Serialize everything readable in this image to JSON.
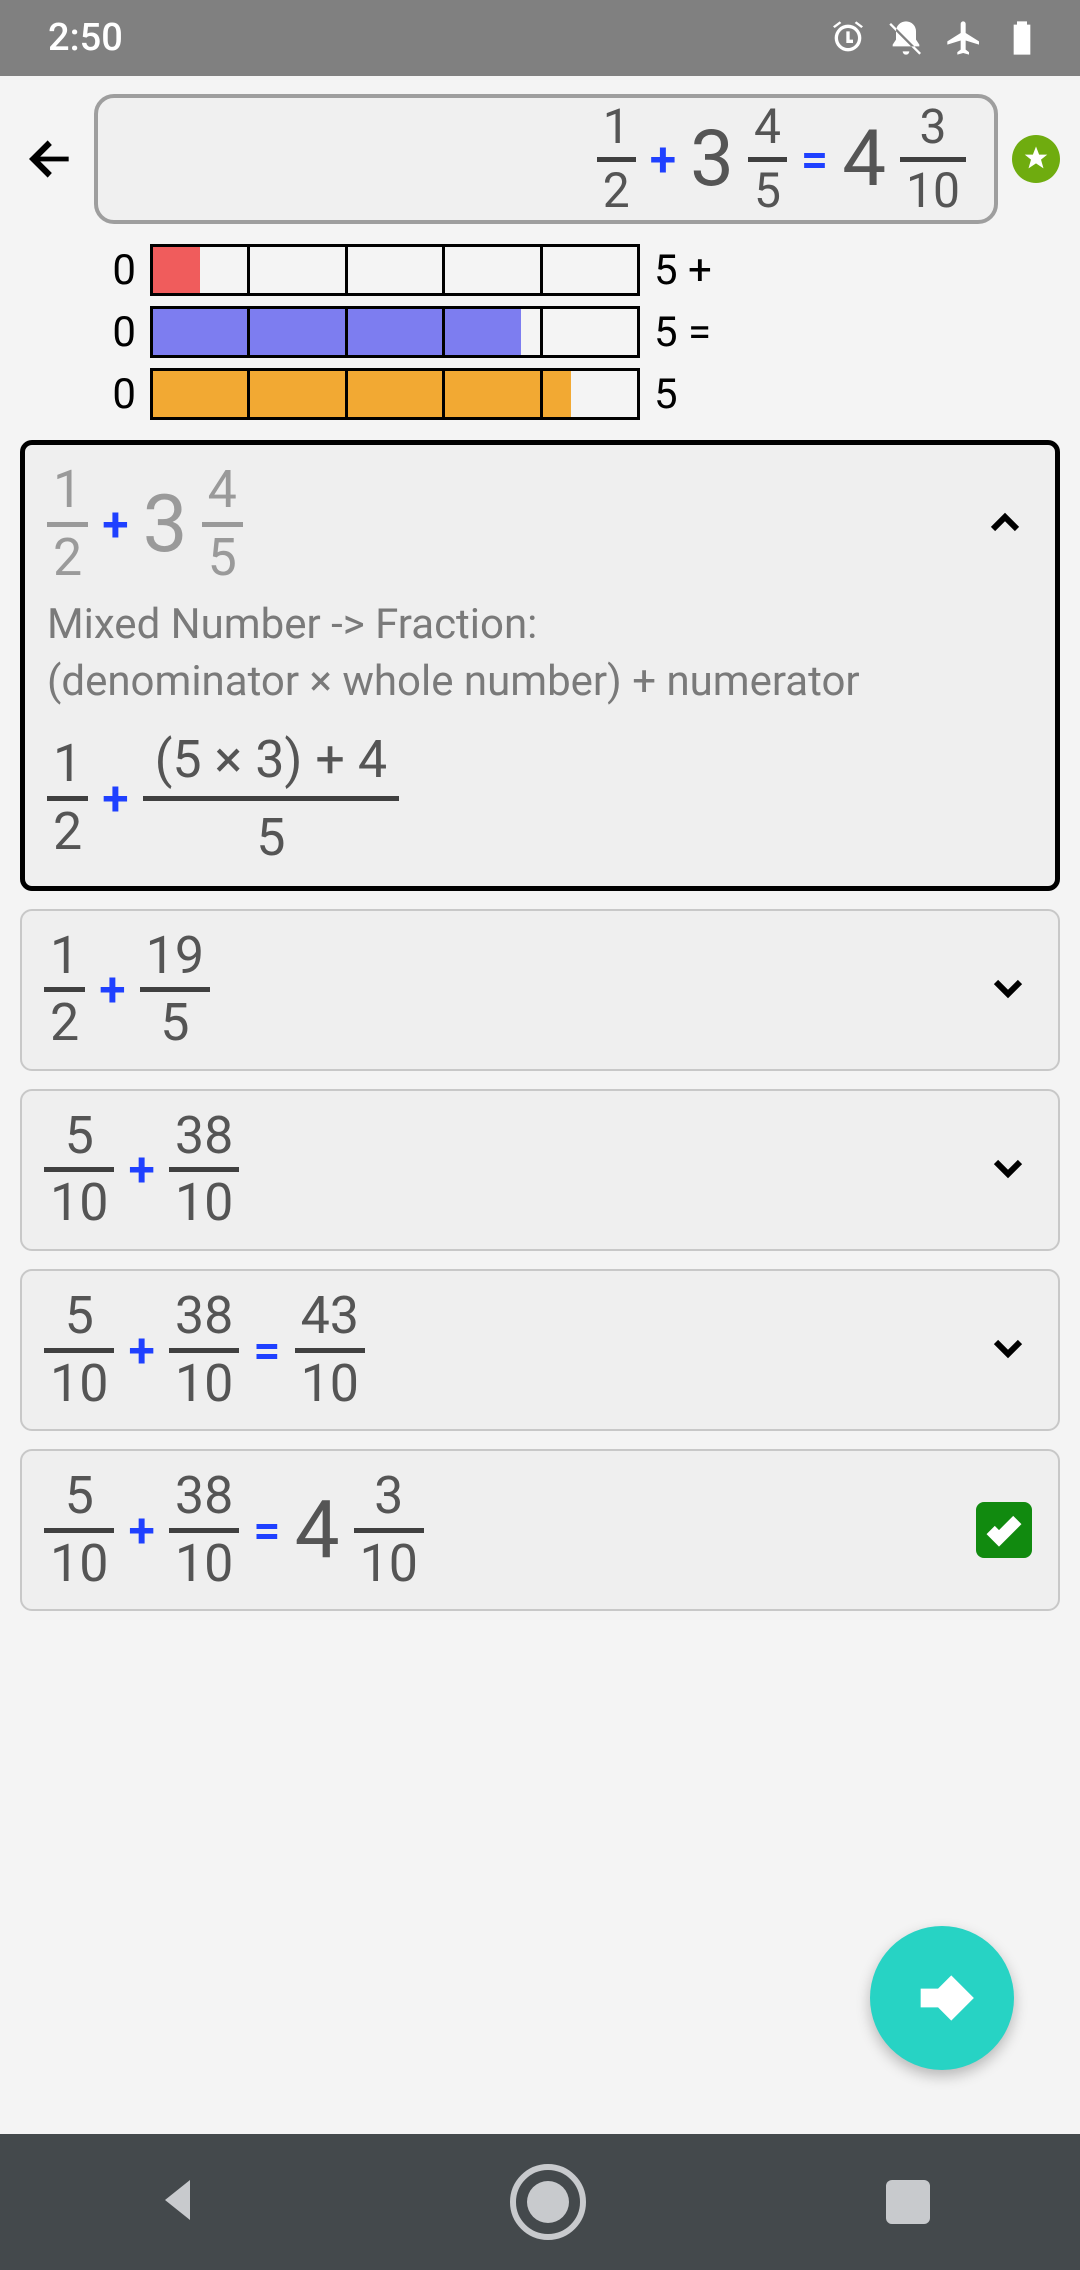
{
  "status": {
    "time": "2:50"
  },
  "header": {
    "f1": {
      "num": "1",
      "den": "2"
    },
    "plus": "+",
    "m2": {
      "whole": "3",
      "num": "4",
      "den": "5"
    },
    "eq": "=",
    "res": {
      "whole": "4",
      "num": "3",
      "den": "10"
    }
  },
  "tapes": {
    "rows": [
      {
        "left": "0",
        "right": "5 +",
        "fill_first_cell_ratio": 0.5,
        "color": "red"
      },
      {
        "left": "0",
        "right": "5 =",
        "full_cells": 3,
        "partial_ratio": 0.8,
        "color": "blue"
      },
      {
        "left": "0",
        "right": "5",
        "full_cells": 4,
        "partial_ratio": 0.3,
        "color": "orange"
      }
    ]
  },
  "steps": {
    "s1": {
      "line1": {
        "f1": {
          "num": "1",
          "den": "2"
        },
        "plus": "+",
        "m2": {
          "whole": "3",
          "num": "4",
          "den": "5"
        }
      },
      "note_l1": "Mixed Number -> Fraction:",
      "note_l2": "(denominator × whole number) + numerator",
      "line2": {
        "f1": {
          "num": "1",
          "den": "2"
        },
        "plus": "+",
        "wide": {
          "num": "(5 × 3) + 4",
          "den": "5"
        }
      }
    },
    "s2": {
      "f1": {
        "num": "1",
        "den": "2"
      },
      "plus": "+",
      "f2": {
        "num": "19",
        "den": "5"
      }
    },
    "s3": {
      "f1": {
        "num": "5",
        "den": "10"
      },
      "plus": "+",
      "f2": {
        "num": "38",
        "den": "10"
      }
    },
    "s4": {
      "f1": {
        "num": "5",
        "den": "10"
      },
      "plus": "+",
      "f2": {
        "num": "38",
        "den": "10"
      },
      "eq": "=",
      "f3": {
        "num": "43",
        "den": "10"
      }
    },
    "s5": {
      "f1": {
        "num": "5",
        "den": "10"
      },
      "plus": "+",
      "f2": {
        "num": "38",
        "den": "10"
      },
      "eq": "=",
      "mr": {
        "whole": "4",
        "num": "3",
        "den": "10"
      }
    }
  }
}
